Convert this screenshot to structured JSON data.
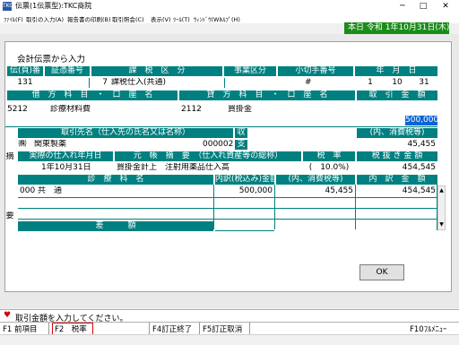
{
  "window": {
    "title": "伝票(1伝票型):TKC商院",
    "icon_text": "TKC"
  },
  "menu": [
    "ﾌｧｲﾙ(F)",
    "取引の入力(A)",
    "報告書の印刷(B)",
    "取引照会(C)",
    "表示(V)",
    "ﾂｰﾙ(T)",
    "ｳｨﾝﾄﾞｳ(W)",
    "ﾍﾙﾌﾟ(H)"
  ],
  "date_bar": "本日 令和 1年10月31日(木)",
  "dialog": {
    "title": "会計伝票から入力",
    "ok_label": "OK"
  },
  "header": {
    "labels": [
      "伝(頁)番",
      "証憑番号",
      "課　税　区　分",
      "事業区分",
      "小切手番号",
      "年　月　日"
    ],
    "values": {
      "slip_no": "131",
      "tax_code": "7",
      "tax_name": "課税仕入(共通)",
      "check_mark": "#",
      "year": "1",
      "month": "10",
      "day": "31"
    }
  },
  "accounts": {
    "debit_label": "借　方　科　目　・　口　座　名",
    "credit_label": "貸　方　科　目　・　口　座　名",
    "amount_label": "取　引　金　額",
    "debit_code": "5212",
    "debit_name": "診療材料費",
    "credit_code": "2112",
    "credit_name": "買掛金",
    "amount": "500,000"
  },
  "partner": {
    "label": "取引先名（仕入先の氏名又は名称）",
    "short_label": "収",
    "tax_label": "(内、消費税等)",
    "prefix": "㈱",
    "name": "関東製薬",
    "code": "000002",
    "kind": "支",
    "tax": "45,455"
  },
  "summary": {
    "side_labels": [
      "摘",
      "要"
    ],
    "date_label": "実際の仕入れ年月日",
    "desc_label": "元　帳　摘　要　（仕入れ資産等の総称）",
    "rate_label": "税　率",
    "net_label": "税 抜 き 金 額",
    "date": "1年10月31日",
    "desc": "買掛金計上　注射用薬品仕入高",
    "rate": "(　10.0%)",
    "net": "454,545"
  },
  "detail": {
    "headers": [
      "診　療　科　名",
      "内訳(税込み)金額",
      "(内、消費税等)",
      "内　訳　金　額"
    ],
    "rows": [
      {
        "code": "000",
        "name": "共　通",
        "gross": "500,000",
        "tax": "45,455",
        "net": "454,545"
      }
    ],
    "diff_label": "差　　　額"
  },
  "message": "取引金額を入力してください。",
  "fkeys": [
    "F1 前項目",
    "F2　税率",
    "F4訂正終了",
    "F5訂正取消",
    "F10ﾌﾙﾒﾆｭｰ"
  ]
}
